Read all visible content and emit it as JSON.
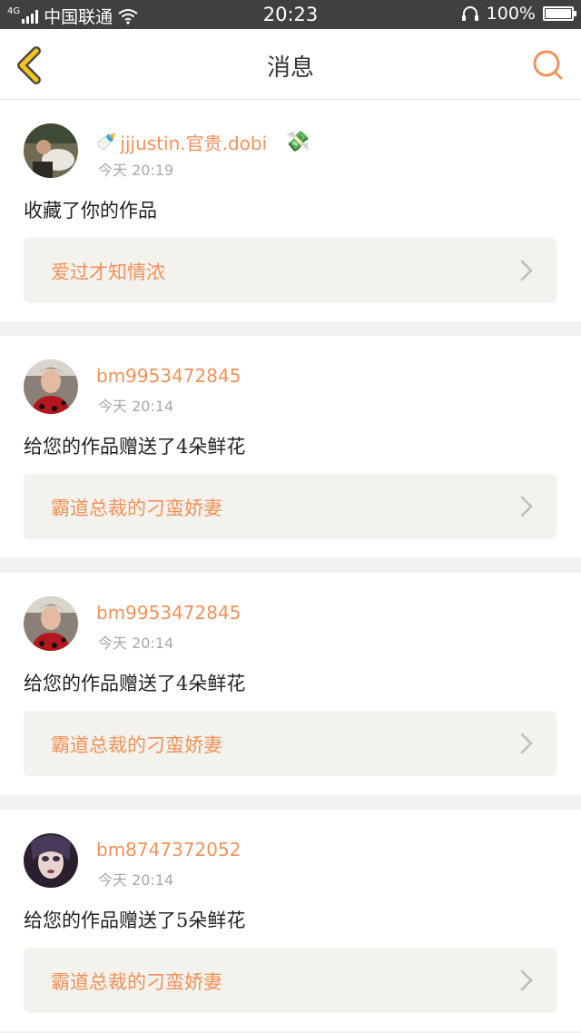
{
  "status_bar": {
    "network": "4G",
    "carrier": "中国联通",
    "time": "20:23",
    "battery": "100%",
    "battery_level": 1.0
  },
  "nav": {
    "title": "消息"
  },
  "messages": [
    {
      "username": "jjjustin.官贵.dobi",
      "time": "今天 20:19",
      "action": "收藏了你的作品",
      "work_title": "爱过才知情浓",
      "emoji_prefix": "🍼",
      "emoji_suffix": "💸"
    },
    {
      "username": "bm9953472845",
      "time": "今天 20:14",
      "action": "给您的作品赠送了4朵鲜花",
      "work_title": "霸道总裁的刁蛮娇妻"
    },
    {
      "username": "bm9953472845",
      "time": "今天 20:14",
      "action": "给您的作品赠送了4朵鲜花",
      "work_title": "霸道总裁的刁蛮娇妻"
    },
    {
      "username": "bm8747372052",
      "time": "今天 20:14",
      "action": "给您的作品赠送了5朵鲜花",
      "work_title": "霸道总裁的刁蛮娇妻"
    }
  ],
  "colors": {
    "accent": "#f0925a",
    "back_arrow": "#f5c518",
    "status_bar": "#404040"
  }
}
